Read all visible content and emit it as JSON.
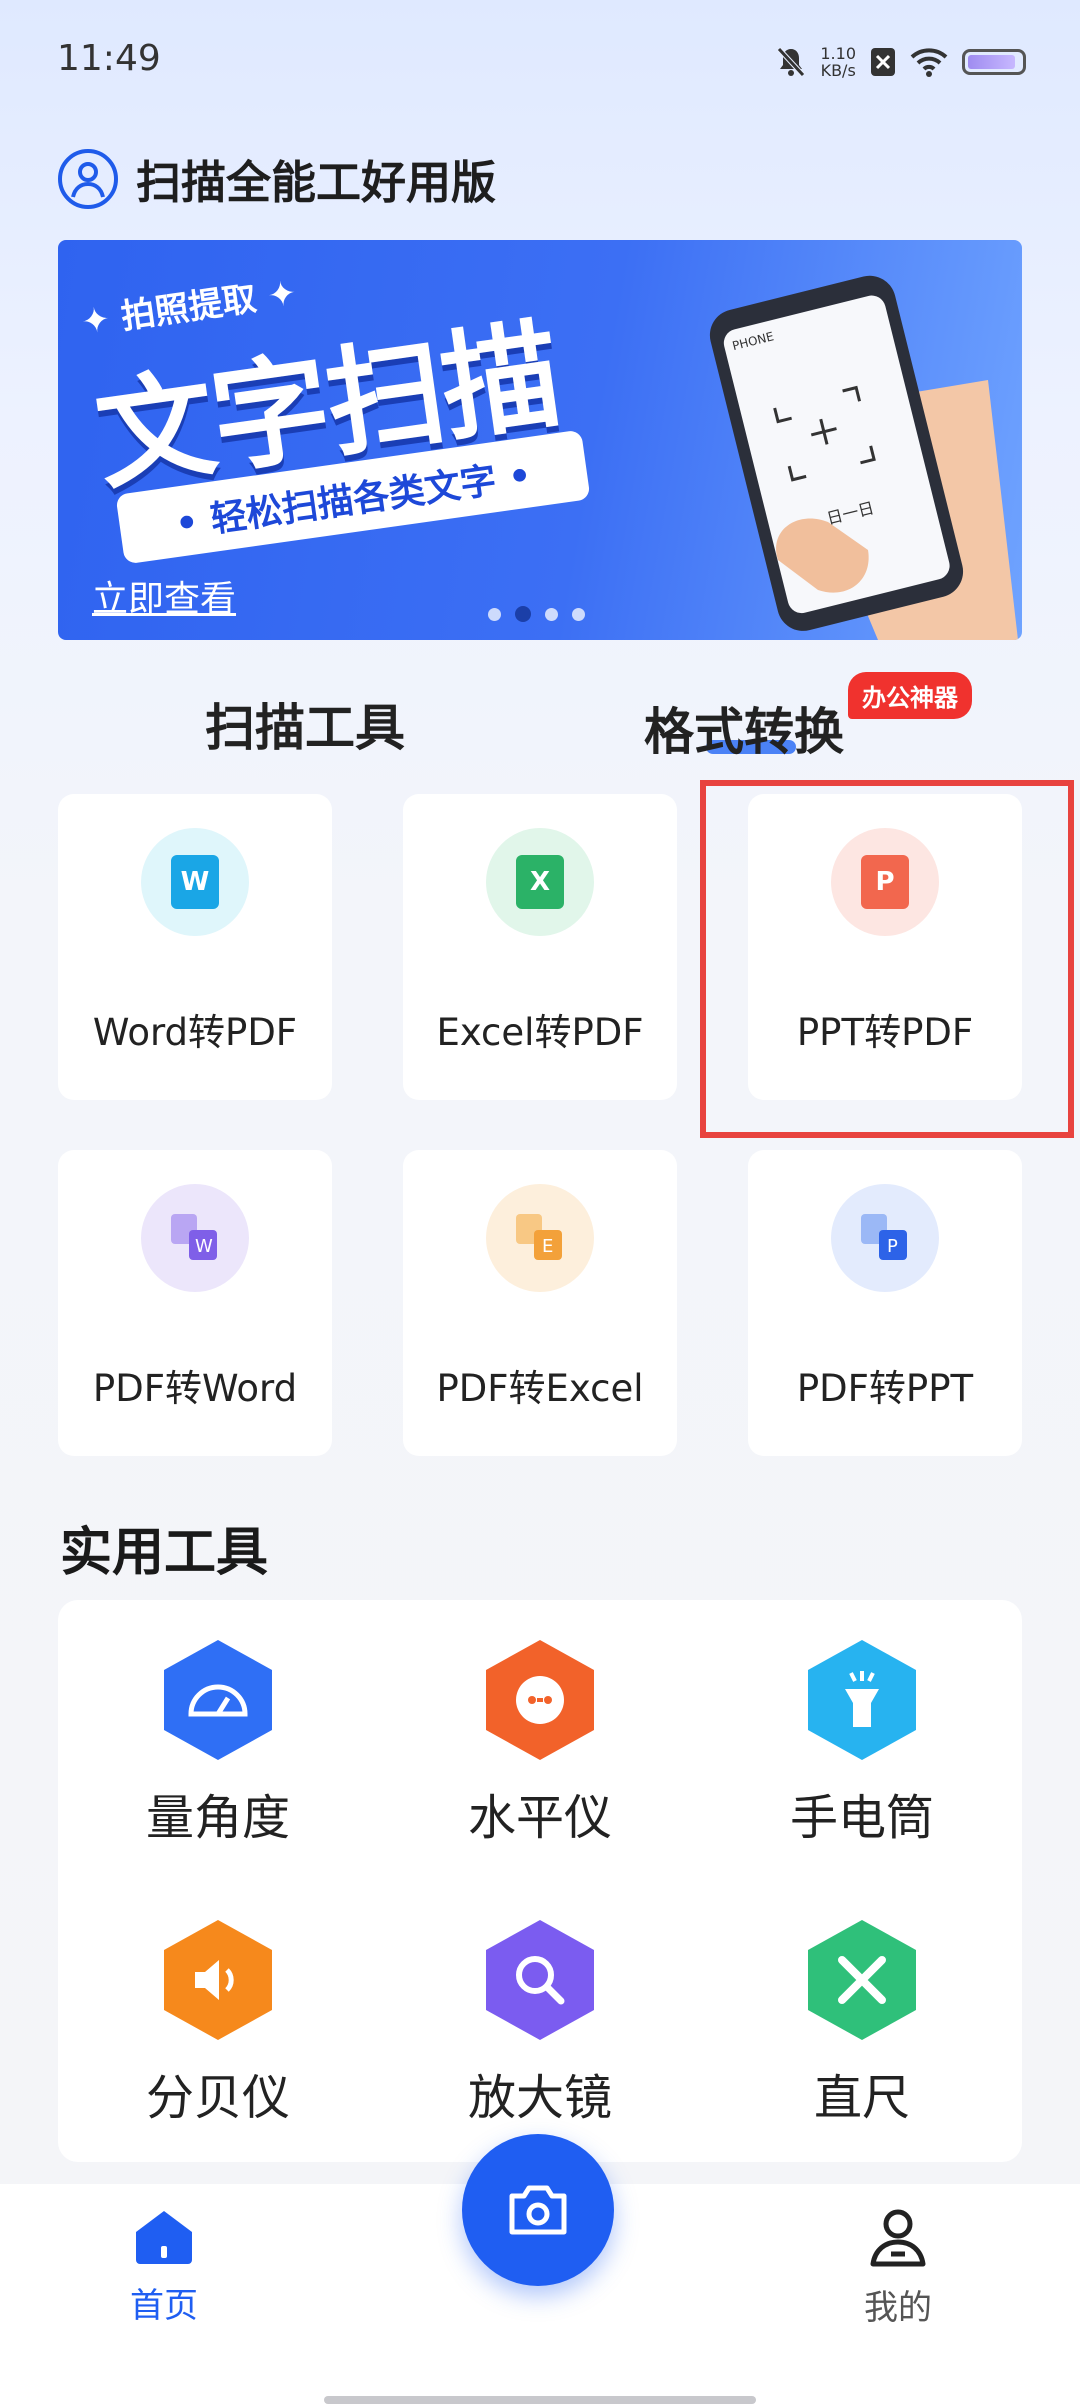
{
  "status_bar": {
    "time": "11:49",
    "speed_value": "1.10",
    "speed_unit": "KB/s"
  },
  "header": {
    "title": "扫描全能工好用版"
  },
  "banner": {
    "subtitle_top": "✦ 拍照提取 ✦",
    "headline": "文字扫描",
    "pill_text": "• 轻松扫描各类文字 •",
    "link": "立即查看",
    "phone_caption": "日一日",
    "phone_status": "PHONE",
    "active_dot": 2,
    "dot_count": 4
  },
  "tabs": [
    {
      "label": "扫描工具"
    },
    {
      "label": "格式转换",
      "badge": "办公神器",
      "selected": true
    }
  ],
  "convert_tools": [
    {
      "label": "Word转PDF",
      "icon": "word-icon"
    },
    {
      "label": "Excel转PDF",
      "icon": "excel-icon"
    },
    {
      "label": "PPT转PDF",
      "icon": "ppt-icon",
      "highlighted": true
    },
    {
      "label": "PDF转Word",
      "icon": "pdf-to-word-icon"
    },
    {
      "label": "PDF转Excel",
      "icon": "pdf-to-excel-icon"
    },
    {
      "label": "PDF转PPT",
      "icon": "pdf-to-ppt-icon"
    }
  ],
  "utility": {
    "title": "实用工具",
    "items": [
      {
        "label": "量角度",
        "icon": "protractor-icon",
        "color": "#2f6ff5"
      },
      {
        "label": "水平仪",
        "icon": "level-icon",
        "color": "#f2622a"
      },
      {
        "label": "手电筒",
        "icon": "flashlight-icon",
        "color": "#27b3f0"
      },
      {
        "label": "分贝仪",
        "icon": "decibel-icon",
        "color": "#f6891c"
      },
      {
        "label": "放大镜",
        "icon": "magnifier-icon",
        "color": "#7b5cf0"
      },
      {
        "label": "直尺",
        "icon": "ruler-icon",
        "color": "#2fc07a"
      }
    ]
  },
  "bottom_nav": {
    "home": {
      "label": "首页",
      "active": true
    },
    "mine": {
      "label": "我的"
    },
    "camera": {
      "icon": "camera-icon"
    }
  },
  "colors": {
    "accent": "#1f5ef2",
    "badge": "#f0322e",
    "highlight_box": "#e8433f"
  }
}
